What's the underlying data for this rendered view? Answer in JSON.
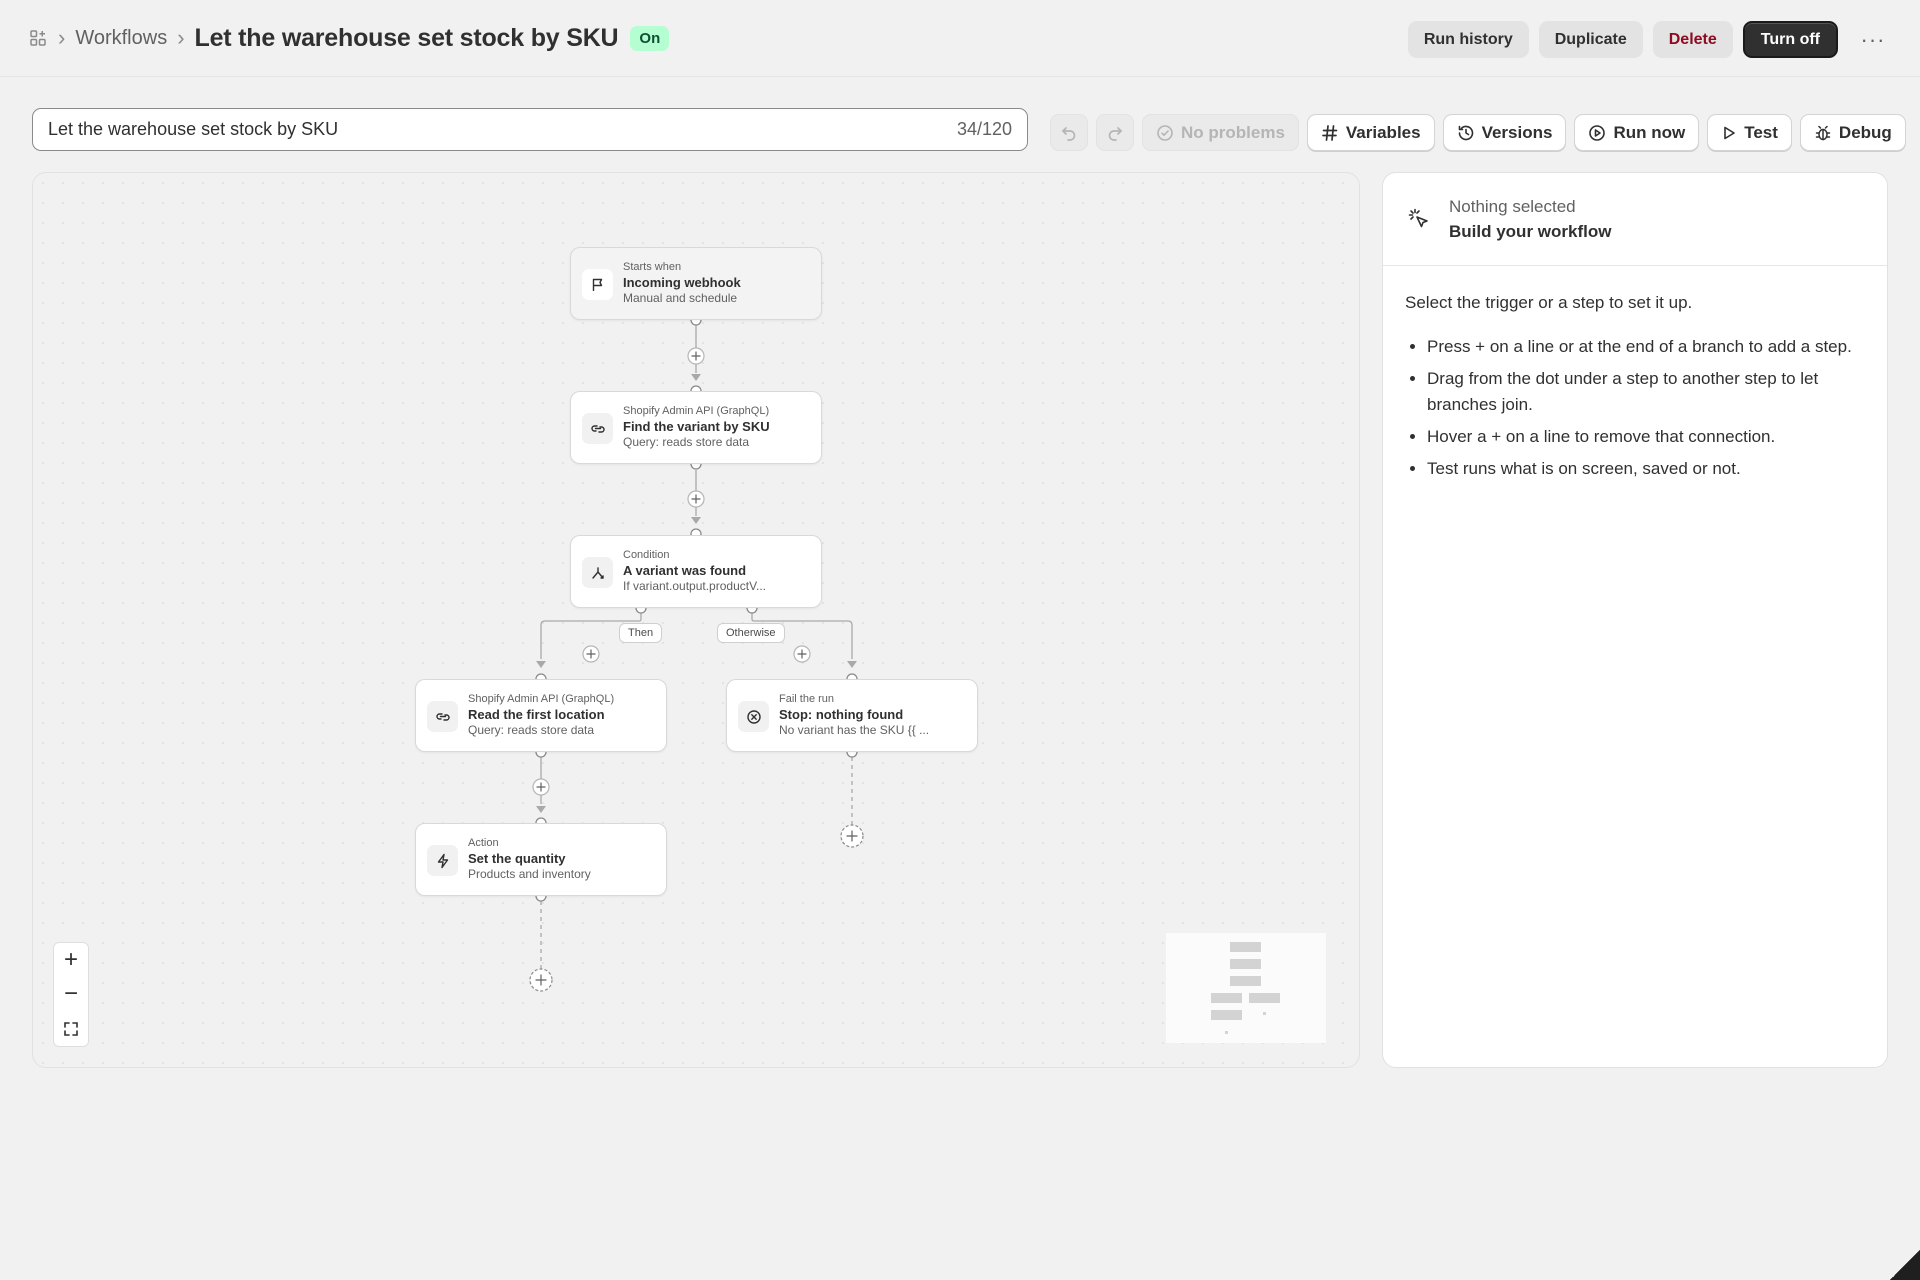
{
  "breadcrumb": {
    "parent": "Workflows",
    "title": "Let the warehouse set stock by SKU",
    "status": "On"
  },
  "header_actions": {
    "run_history": "Run history",
    "duplicate": "Duplicate",
    "delete": "Delete",
    "turn_off": "Turn off",
    "more": "···"
  },
  "name_field": {
    "value": "Let the warehouse set stock by SKU",
    "counter": "34/120"
  },
  "toolbar": {
    "no_problems": "No problems",
    "variables": "Variables",
    "versions": "Versions",
    "run_now": "Run now",
    "test": "Test",
    "debug": "Debug"
  },
  "nodes": {
    "trigger": {
      "kicker": "Starts when",
      "title": "Incoming webhook",
      "sub": "Manual and schedule"
    },
    "find_variant": {
      "kicker": "Shopify Admin API (GraphQL)",
      "title": "Find the variant by SKU",
      "sub": "Query: reads store data"
    },
    "condition": {
      "kicker": "Condition",
      "title": "A variant was found",
      "sub": "If variant.output.productV..."
    },
    "read_location": {
      "kicker": "Shopify Admin API (GraphQL)",
      "title": "Read the first location",
      "sub": "Query: reads store data"
    },
    "stop": {
      "kicker": "Fail the run",
      "title": "Stop: nothing found",
      "sub": "No variant has the SKU {{ ..."
    },
    "set_quantity": {
      "kicker": "Action",
      "title": "Set the quantity",
      "sub": "Products and inventory"
    }
  },
  "branches": {
    "then": "Then",
    "otherwise": "Otherwise"
  },
  "zoom": {
    "in": "+",
    "out": "−"
  },
  "panel": {
    "muted": "Nothing selected",
    "title": "Build your workflow",
    "lead": "Select the trigger or a step to set it up.",
    "tips": [
      "Press + on a line or at the end of a branch to add a step.",
      "Drag from the dot under a step to another step to let branches join.",
      "Hover a + on a line to remove that connection.",
      "Test runs what is on screen, saved or not."
    ]
  },
  "colors": {
    "status_on_bg": "#b4fed2",
    "danger_text": "#8e0b21",
    "primary_button": "#303030"
  }
}
